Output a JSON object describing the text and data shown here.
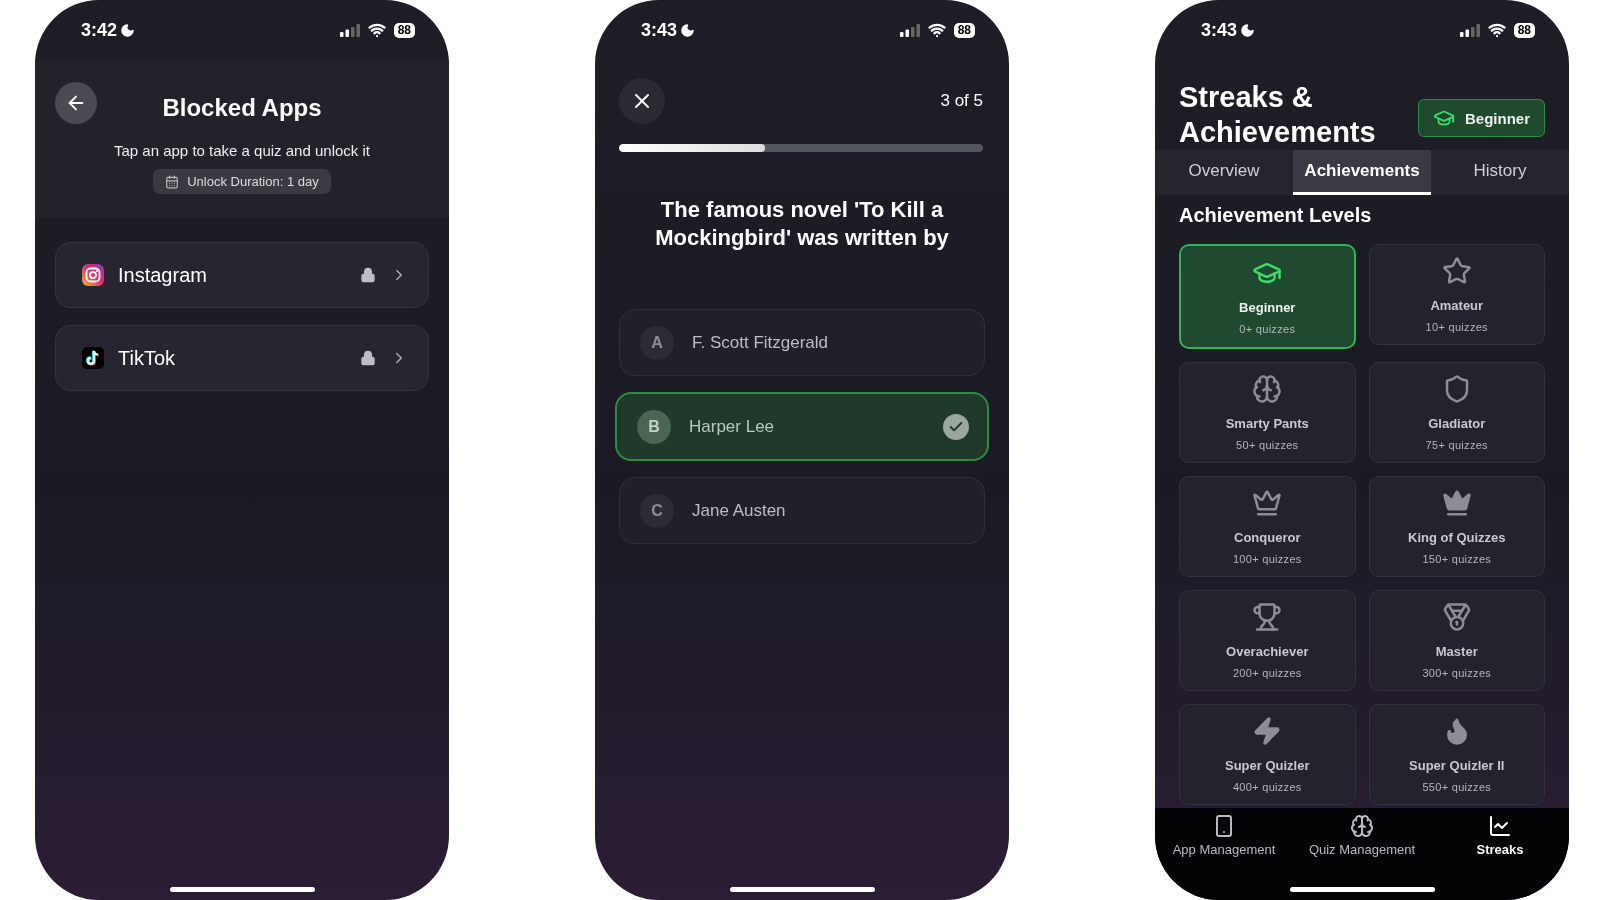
{
  "phones": [
    {
      "kind": "blocked_apps",
      "status": {
        "time": "3:42",
        "battery": "88"
      },
      "title": "Blocked Apps",
      "subtitle": "Tap an app to take a quiz and unlock it",
      "duration": "Unlock Duration: 1 day",
      "apps": [
        {
          "name": "Instagram",
          "kind": "instagram",
          "locked": true
        },
        {
          "name": "TikTok",
          "kind": "tiktok",
          "locked": true
        }
      ]
    },
    {
      "kind": "quiz",
      "status": {
        "time": "3:43",
        "battery": "88"
      },
      "counter": "3 of 5",
      "progress": {
        "level": 0.4
      },
      "question": "The famous novel 'To Kill a Mockingbird' was written by",
      "options": [
        {
          "letter": "A",
          "text": "F. Scott Fitzgerald",
          "selected": false
        },
        {
          "letter": "B",
          "text": "Harper Lee",
          "selected": true
        },
        {
          "letter": "C",
          "text": "Jane Austen",
          "selected": false
        }
      ]
    },
    {
      "kind": "achievements",
      "status": {
        "time": "3:43",
        "battery": "88"
      },
      "title": "Streaks & Achievements",
      "badge": "Beginner",
      "tabs": [
        {
          "label": "Overview",
          "selected": false
        },
        {
          "label": "Achievements",
          "selected": true
        },
        {
          "label": "History",
          "selected": false
        }
      ],
      "section": "Achievement Levels",
      "levels": [
        {
          "name": "Beginner",
          "requirement": "0+ quizzes",
          "kind": "cap",
          "selected": true
        },
        {
          "name": "Amateur",
          "requirement": "10+ quizzes",
          "kind": "star",
          "selected": false
        },
        {
          "name": "Smarty Pants",
          "requirement": "50+ quizzes",
          "kind": "brain",
          "selected": false
        },
        {
          "name": "Gladiator",
          "requirement": "75+ quizzes",
          "kind": "shield",
          "selected": false
        },
        {
          "name": "Conqueror",
          "requirement": "100+ quizzes",
          "kind": "crown",
          "selected": false
        },
        {
          "name": "King of Quizzes",
          "requirement": "150+ quizzes",
          "kind": "crown-filled",
          "selected": false
        },
        {
          "name": "Overachiever",
          "requirement": "200+ quizzes",
          "kind": "trophy",
          "selected": false
        },
        {
          "name": "Master",
          "requirement": "300+ quizzes",
          "kind": "medal",
          "selected": false
        },
        {
          "name": "Super Quizler",
          "requirement": "400+ quizzes",
          "kind": "bolt",
          "selected": false
        },
        {
          "name": "Super Quizler II",
          "requirement": "550+ quizzes",
          "kind": "flame",
          "selected": false
        }
      ],
      "nav": [
        {
          "label": "App Management",
          "kind": "phone",
          "selected": false
        },
        {
          "label": "Quiz Management",
          "kind": "head",
          "selected": false
        },
        {
          "label": "Streaks",
          "kind": "chart",
          "selected": true
        }
      ]
    }
  ]
}
